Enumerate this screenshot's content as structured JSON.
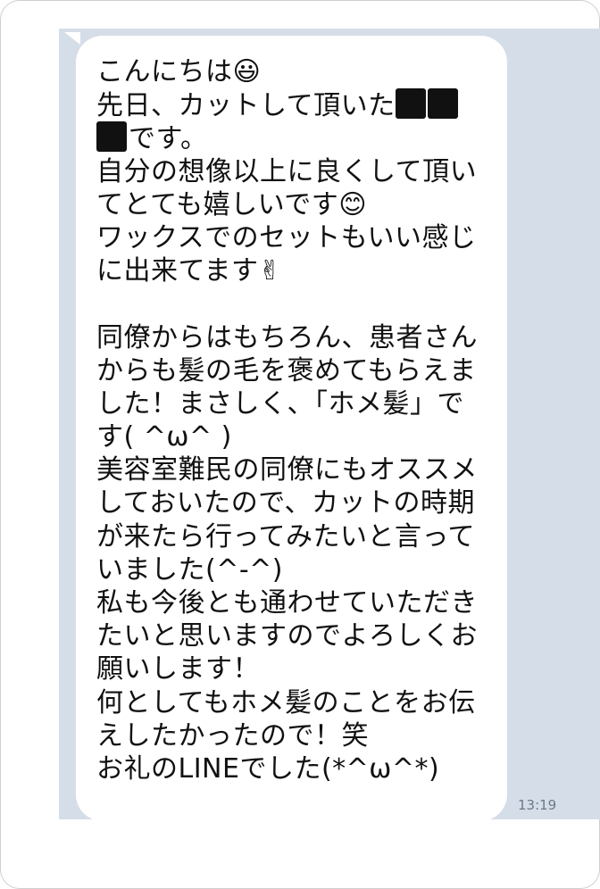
{
  "message": {
    "lines": [
      "こんにちは😃",
      "先日、カットして頂いた",
      "です。",
      "自分の想像以上に良くして頂い",
      "てとても嬉しいです😊",
      "ワックスでのセットもいい感じ",
      "に出来てます✌",
      "",
      "同僚からはもちろん、患者さん",
      "からも髪の毛を褒めてもらえま",
      "した！まさしく、「ホメ髪」で",
      "す( ^ω^ )",
      "美容室難民の同僚にもオススメ",
      "しておいたので、カットの時期",
      "が来たら行ってみたいと言って",
      "いました(^-^)",
      "私も今後とも通わせていただき",
      "たいと思いますのでよろしくお",
      "願いします！",
      "何としてもホメ髪のことをお伝",
      "えしたかったので！笑",
      "お礼のLINEでした(*^ω^*)"
    ]
  },
  "timestamp": "13:19"
}
